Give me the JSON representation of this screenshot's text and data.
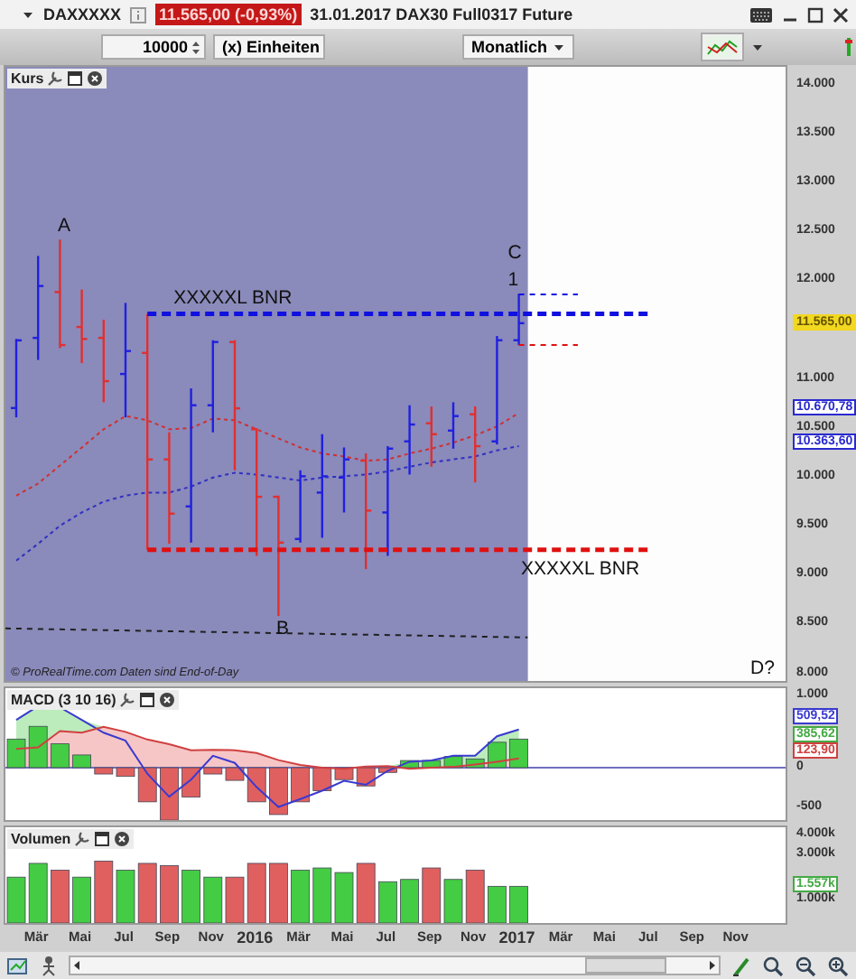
{
  "title_bar": {
    "symbol": "DAXXXXX",
    "quote": "11.565,00 (-0,93%)",
    "description": "31.01.2017 DAX30 Full0317 Future"
  },
  "toolbar": {
    "quantity": "10000",
    "unit": "(x) Einheiten",
    "period": "Monatlich"
  },
  "price_panel": {
    "title": "Kurs",
    "source_note": "© ProRealTime.com  Daten sind End-of-Day",
    "axis_labels": [
      "14.000",
      "13.500",
      "13.000",
      "12.500",
      "12.000",
      "11.000",
      "10.500",
      "10.000",
      "9.500",
      "9.000",
      "8.500",
      "8.000"
    ],
    "chart_labels": [
      "XXXXXL BNR",
      "XXXXXL BNR",
      "A",
      "B",
      "C",
      "1",
      "D?"
    ],
    "readings": [
      {
        "text": "11.565,00",
        "color": "#f2d820"
      },
      {
        "text": "10.670,78",
        "color": "#2a2ad0"
      },
      {
        "text": "10.363,60",
        "color": "#2a2ad0"
      }
    ]
  },
  "macd_panel": {
    "title": "MACD (3 10 16)",
    "axis_labels": [
      "1.000",
      "0",
      "-500"
    ],
    "readings": [
      {
        "text": "509,52",
        "color": "#3a3ad0"
      },
      {
        "text": "385,62",
        "color": "#44aa44"
      },
      {
        "text": "123,90",
        "color": "#d04040"
      }
    ]
  },
  "volume_panel": {
    "title": "Volumen",
    "axis_labels": [
      "4.000k",
      "3.000k",
      "1.000k"
    ],
    "readings": [
      {
        "text": "1.557k",
        "color": "#44aa44"
      }
    ]
  },
  "x_axis": {
    "labels": [
      {
        "text": "Mär",
        "kind": "month"
      },
      {
        "text": "Mai",
        "kind": "month"
      },
      {
        "text": "Jul",
        "kind": "month"
      },
      {
        "text": "Sep",
        "kind": "month"
      },
      {
        "text": "Nov",
        "kind": "month"
      },
      {
        "text": "2016",
        "kind": "year"
      },
      {
        "text": "Mär",
        "kind": "month"
      },
      {
        "text": "Mai",
        "kind": "month"
      },
      {
        "text": "Jul",
        "kind": "month"
      },
      {
        "text": "Sep",
        "kind": "month"
      },
      {
        "text": "Nov",
        "kind": "month"
      },
      {
        "text": "2017",
        "kind": "year"
      },
      {
        "text": "Mär",
        "kind": "month"
      },
      {
        "text": "Mai",
        "kind": "month"
      },
      {
        "text": "Jul",
        "kind": "month"
      },
      {
        "text": "Sep",
        "kind": "month"
      },
      {
        "text": "Nov",
        "kind": "month"
      }
    ]
  }
}
